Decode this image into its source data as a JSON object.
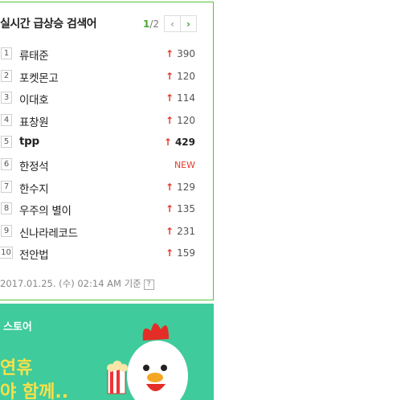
{
  "widget": {
    "title": "실시간 급상승 검색어",
    "page_current": "1",
    "page_total": "/2",
    "prev_icon": "chevron-left-icon",
    "next_icon": "chevron-right-icon"
  },
  "items": [
    {
      "rank": "1",
      "keyword": "류태준",
      "change": "390",
      "type": "up"
    },
    {
      "rank": "2",
      "keyword": "포켓몬고",
      "change": "120",
      "type": "up"
    },
    {
      "rank": "3",
      "keyword": "이대호",
      "change": "114",
      "type": "up"
    },
    {
      "rank": "4",
      "keyword": "표창원",
      "change": "120",
      "type": "up"
    },
    {
      "rank": "5",
      "keyword": "tpp",
      "change": "429",
      "type": "up",
      "bold": true
    },
    {
      "rank": "6",
      "keyword": "한정석",
      "change": "NEW",
      "type": "new"
    },
    {
      "rank": "7",
      "keyword": "한수지",
      "change": "129",
      "type": "up"
    },
    {
      "rank": "8",
      "keyword": "우주의 별이",
      "change": "135",
      "type": "up"
    },
    {
      "rank": "9",
      "keyword": "신나라레코드",
      "change": "231",
      "type": "up"
    },
    {
      "rank": "10",
      "keyword": "전안법",
      "change": "159",
      "type": "up"
    }
  ],
  "footer": {
    "timestamp": "2017.01.25. (수) 02:14 AM 기준",
    "help_label": "?"
  },
  "banner": {
    "title": "스토어",
    "line1": "연휴",
    "line2": "야 함께..",
    "colors": {
      "background": "#3fcb9b",
      "text_accent": "#f7e04a"
    }
  },
  "colors": {
    "border": "#55c33a",
    "up_arrow": "#e0392b",
    "new": "#e0392b",
    "page_accent": "#4aa935"
  }
}
